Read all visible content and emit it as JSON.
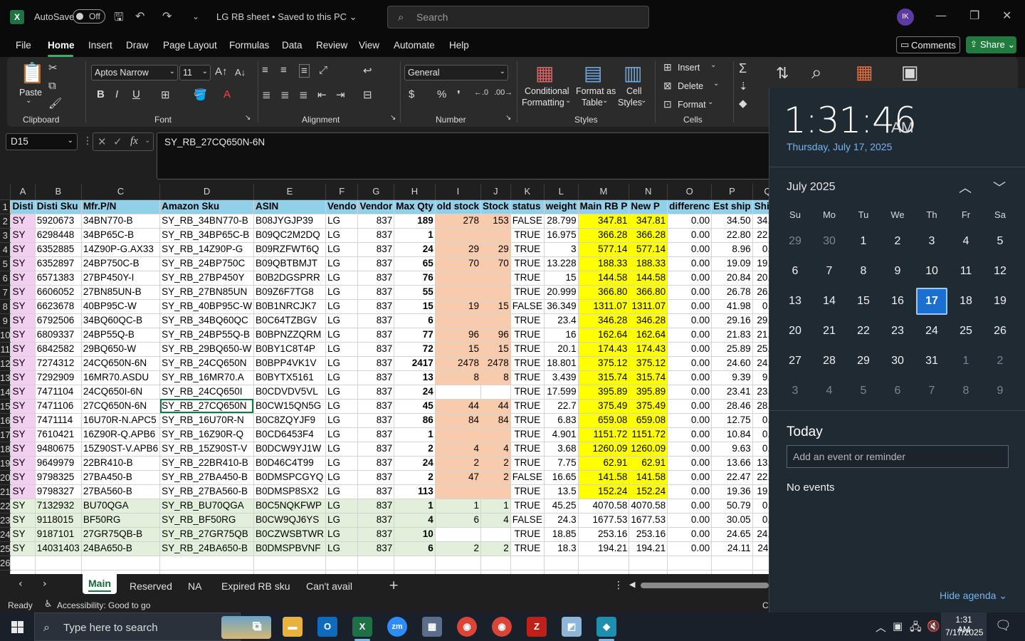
{
  "titlebar": {
    "autosave_label": "AutoSave",
    "autosave_state": "Off",
    "title": "LG RB sheet • Saved to this PC ⌄",
    "search_placeholder": "Search",
    "avatar_initials": "IK"
  },
  "menu": {
    "items": [
      "File",
      "Home",
      "Insert",
      "Draw",
      "Page Layout",
      "Formulas",
      "Data",
      "Review",
      "View",
      "Automate",
      "Help"
    ],
    "comments": "Comments",
    "share": "Share"
  },
  "ribbon": {
    "clipboard_label": "Clipboard",
    "paste": "Paste",
    "font_label": "Font",
    "font_name": "Aptos Narrow",
    "font_size": "11",
    "alignment_label": "Alignment",
    "number_label": "Number",
    "number_format": "General",
    "styles_label": "Styles",
    "cond_fmt_1": "Conditional",
    "cond_fmt_2": "Formatting",
    "fmt_table_1": "Format as",
    "fmt_table_2": "Table",
    "cell_styles_1": "Cell",
    "cell_styles_2": "Styles",
    "cells_label": "Cells",
    "insert": "Insert",
    "delete": "Delete",
    "format": "Format"
  },
  "formula_bar": {
    "name_box": "D15",
    "fx": "fx",
    "formula": "SY_RB_27CQ650N-6N"
  },
  "sheet": {
    "columns": [
      "A",
      "B",
      "C",
      "D",
      "E",
      "F",
      "G",
      "H",
      "I",
      "J",
      "K",
      "L",
      "M",
      "N",
      "O",
      "P",
      "Q"
    ],
    "header_row": [
      "Disti",
      "Disti Sku",
      "Mfr.P/N",
      "Amazon Sku",
      "ASIN",
      "Vendo",
      "Vendor",
      "Max Qty",
      "old stock",
      "Stock",
      "status",
      "weight",
      "Main RB P",
      "New P",
      "differenc",
      "Est ship",
      "Shipp"
    ],
    "rows": [
      [
        "SY",
        "5920673",
        "34BN770-B",
        "SY_RB_34BN770-B",
        "B08JYGJP39",
        "LG",
        "837",
        "189",
        "278",
        "153",
        "FALSE",
        "28.799",
        "347.81",
        "347.81",
        "0.00",
        "34.50",
        "34.50"
      ],
      [
        "SY",
        "6298448",
        "34BP65C-B",
        "SY_RB_34BP65C-B",
        "B09QC2M2DQ",
        "LG",
        "837",
        "1",
        "",
        "",
        "TRUE",
        "16.975",
        "366.28",
        "366.28",
        "0.00",
        "22.80",
        "22.80"
      ],
      [
        "SY",
        "6352885",
        "14Z90P-G.AX33",
        "SY_RB_14Z90P-G",
        "B09RZFWT6Q",
        "LG",
        "837",
        "24",
        "29",
        "29",
        "TRUE",
        "3",
        "577.14",
        "577.14",
        "0.00",
        "8.96",
        "0.00"
      ],
      [
        "SY",
        "6352897",
        "24BP750C-B",
        "SY_RB_24BP750C",
        "B09QBTBMJT",
        "LG",
        "837",
        "65",
        "70",
        "70",
        "TRUE",
        "13.228",
        "188.33",
        "188.33",
        "0.00",
        "19.09",
        "19.09"
      ],
      [
        "SY",
        "6571383",
        "27BP450Y-I",
        "SY_RB_27BP450Y",
        "B0B2DGSPRR",
        "LG",
        "837",
        "76",
        "",
        "",
        "TRUE",
        "15",
        "144.58",
        "144.58",
        "0.00",
        "20.84",
        "20.84"
      ],
      [
        "SY",
        "6606052",
        "27BN85UN-B",
        "SY_RB_27BN85UN",
        "B09Z6F7TG8",
        "LG",
        "837",
        "55",
        "",
        "",
        "TRUE",
        "20.999",
        "366.80",
        "366.80",
        "0.00",
        "26.78",
        "26.78"
      ],
      [
        "SY",
        "6623678",
        "40BP95C-W",
        "SY_RB_40BP95C-W",
        "B0B1NRCJK7",
        "LG",
        "837",
        "15",
        "19",
        "15",
        "FALSE",
        "36.349",
        "1311.07",
        "1311.07",
        "0.00",
        "41.98",
        "0.00"
      ],
      [
        "SY",
        "6792506",
        "34BQ60QC-B",
        "SY_RB_34BQ60QC",
        "B0C64TZBGV",
        "LG",
        "837",
        "6",
        "",
        "",
        "TRUE",
        "23.4",
        "346.28",
        "346.28",
        "0.00",
        "29.16",
        "29.16"
      ],
      [
        "SY",
        "6809337",
        "24BP55Q-B",
        "SY_RB_24BP55Q-B",
        "B0BPNZZQRM",
        "LG",
        "837",
        "77",
        "96",
        "96",
        "TRUE",
        "16",
        "162.64",
        "162.64",
        "0.00",
        "21.83",
        "21.83"
      ],
      [
        "SY",
        "6842582",
        "29BQ650-W",
        "SY_RB_29BQ650-W",
        "B0BY1C8T4P",
        "LG",
        "837",
        "72",
        "15",
        "15",
        "TRUE",
        "20.1",
        "174.43",
        "174.43",
        "0.00",
        "25.89",
        "25.89"
      ],
      [
        "SY",
        "7274312",
        "24CQ650N-6N",
        "SY_RB_24CQ650N",
        "B0BPP4VK1V",
        "LG",
        "837",
        "2417",
        "2478",
        "2478",
        "TRUE",
        "18.801",
        "375.12",
        "375.12",
        "0.00",
        "24.60",
        "24.60"
      ],
      [
        "SY",
        "7292909",
        "16MR70.ASDU",
        "SY_RB_16MR70.A",
        "B0BYTX5161",
        "LG",
        "837",
        "13",
        "8",
        "8",
        "TRUE",
        "3.439",
        "315.74",
        "315.74",
        "0.00",
        "9.39",
        "9.39"
      ],
      [
        "SY",
        "7471104",
        "24CQ650I-6N",
        "SY_RB_24CQ650I",
        "B0CDVDV5VL",
        "LG",
        "837",
        "24",
        "",
        "",
        "TRUE",
        "17.599",
        "395.89",
        "395.89",
        "0.00",
        "23.41",
        "23.41"
      ],
      [
        "SY",
        "7471106",
        "27CQ650N-6N",
        "SY_RB_27CQ650N",
        "B0CW15QN5G",
        "LG",
        "837",
        "45",
        "44",
        "44",
        "TRUE",
        "22.7",
        "375.49",
        "375.49",
        "0.00",
        "28.46",
        "28.46"
      ],
      [
        "SY",
        "7471114",
        "16U70R-N.APC5",
        "SY_RB_16U70R-N",
        "B0C8ZQYJF9",
        "LG",
        "837",
        "86",
        "84",
        "84",
        "TRUE",
        "6.83",
        "659.08",
        "659.08",
        "0.00",
        "12.75",
        "0.00"
      ],
      [
        "SY",
        "7610421",
        "16Z90R-Q.APB6",
        "SY_RB_16Z90R-Q",
        "B0CD6453F4",
        "LG",
        "837",
        "1",
        "",
        "",
        "TRUE",
        "4.901",
        "1151.72",
        "1151.72",
        "0.00",
        "10.84",
        "0.00"
      ],
      [
        "SY",
        "9480675",
        "15Z90ST-V.APB6",
        "SY_RB_15Z90ST-V",
        "B0DCW9YJ1W",
        "LG",
        "837",
        "2",
        "4",
        "4",
        "TRUE",
        "3.68",
        "1260.09",
        "1260.09",
        "0.00",
        "9.63",
        "0.00"
      ],
      [
        "SY",
        "9649979",
        "22BR410-B",
        "SY_RB_22BR410-B",
        "B0D46C4T99",
        "LG",
        "837",
        "24",
        "2",
        "2",
        "TRUE",
        "7.75",
        "62.91",
        "62.91",
        "0.00",
        "13.66",
        "13.66"
      ],
      [
        "SY",
        "9798325",
        "27BA450-B",
        "SY_RB_27BA450-B",
        "B0DMSPCGYQ",
        "LG",
        "837",
        "2",
        "47",
        "2",
        "FALSE",
        "16.65",
        "141.58",
        "141.58",
        "0.00",
        "22.47",
        "22.47"
      ],
      [
        "SY",
        "9798327",
        "27BA560-B",
        "SY_RB_27BA560-B",
        "B0DMSP8SX2",
        "LG",
        "837",
        "113",
        "",
        "",
        "TRUE",
        "13.5",
        "152.24",
        "152.24",
        "0.00",
        "19.36",
        "19.36"
      ],
      [
        "SY",
        "7132932",
        "BU70QGA",
        "SY_RB_BU70QGA",
        "B0C5NQKFWP",
        "LG",
        "837",
        "1",
        "1",
        "1",
        "TRUE",
        "45.25",
        "4070.58",
        "4070.58",
        "0.00",
        "50.79",
        "0.00"
      ],
      [
        "SY",
        "9118015",
        "BF50RG",
        "SY_RB_BF50RG",
        "B0CW9QJ6YS",
        "LG",
        "837",
        "4",
        "6",
        "4",
        "FALSE",
        "24.3",
        "1677.53",
        "1677.53",
        "0.00",
        "30.05",
        "0.00"
      ],
      [
        "SY",
        "9187101",
        "27GR75QB-B",
        "SY_RB_27GR75QB",
        "B0CZWSBTWR",
        "LG",
        "837",
        "10",
        "",
        "",
        "TRUE",
        "18.85",
        "253.16",
        "253.16",
        "0.00",
        "24.65",
        "24.65"
      ],
      [
        "SY",
        "14031403",
        "24BA650-B",
        "SY_RB_24BA650-B",
        "B0DMSPBVNF",
        "LG",
        "837",
        "6",
        "2",
        "2",
        "TRUE",
        "18.3",
        "194.21",
        "194.21",
        "0.00",
        "24.11",
        "24.11"
      ]
    ],
    "tabs": [
      "Main",
      "Reserved",
      "NA",
      "Expired RB sku",
      "Can't avail"
    ]
  },
  "status": {
    "ready": "Ready",
    "accessibility": "Accessibility: Good to go",
    "right_fragment": "Ci"
  },
  "calendar": {
    "time": "1:31:46",
    "ampm": "AM",
    "date": "Thursday, July 17, 2025",
    "month": "July 2025",
    "weekdays": [
      "Su",
      "Mo",
      "Tu",
      "We",
      "Th",
      "Fr",
      "Sa"
    ],
    "weeks": [
      [
        "29",
        "30",
        "1",
        "2",
        "3",
        "4",
        "5"
      ],
      [
        "6",
        "7",
        "8",
        "9",
        "10",
        "11",
        "12"
      ],
      [
        "13",
        "14",
        "15",
        "16",
        "17",
        "18",
        "19"
      ],
      [
        "20",
        "21",
        "22",
        "23",
        "24",
        "25",
        "26"
      ],
      [
        "27",
        "28",
        "29",
        "30",
        "31",
        "1",
        "2"
      ],
      [
        "3",
        "4",
        "5",
        "6",
        "7",
        "8",
        "9"
      ]
    ],
    "today_heading": "Today",
    "event_placeholder": "Add an event or reminder",
    "no_events": "No events",
    "hide_agenda": "Hide agenda"
  },
  "taskbar": {
    "search_text": "Type here to search",
    "time": "1:31 AM",
    "date": "7/17/2025"
  }
}
